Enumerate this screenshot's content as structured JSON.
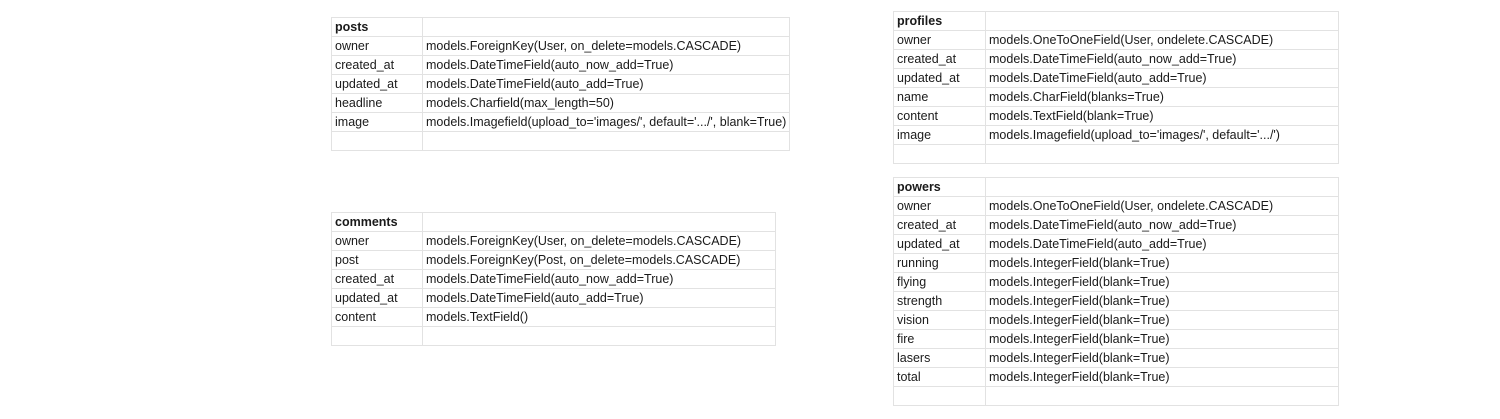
{
  "tables": {
    "posts": {
      "title": "posts",
      "rows": [
        {
          "field": "owner",
          "definition": "models.ForeignKey(User, on_delete=models.CASCADE)"
        },
        {
          "field": "created_at",
          "definition": "models.DateTimeField(auto_now_add=True)"
        },
        {
          "field": "updated_at",
          "definition": "models.DateTimeField(auto_add=True)"
        },
        {
          "field": "headline",
          "definition": "models.Charfield(max_length=50)"
        },
        {
          "field": "image",
          "definition": "models.Imagefield(upload_to='images/', default='.../', blank=True)"
        }
      ]
    },
    "comments": {
      "title": "comments",
      "rows": [
        {
          "field": "owner",
          "definition": "models.ForeignKey(User, on_delete=models.CASCADE)"
        },
        {
          "field": "post",
          "definition": "models.ForeignKey(Post, on_delete=models.CASCADE)"
        },
        {
          "field": "created_at",
          "definition": "models.DateTimeField(auto_now_add=True)"
        },
        {
          "field": "updated_at",
          "definition": "models.DateTimeField(auto_add=True)"
        },
        {
          "field": "content",
          "definition": "models.TextField()"
        }
      ]
    },
    "profiles": {
      "title": "profiles",
      "rows": [
        {
          "field": "owner",
          "definition": "models.OneToOneField(User, ondelete.CASCADE)"
        },
        {
          "field": "created_at",
          "definition": "models.DateTimeField(auto_now_add=True)"
        },
        {
          "field": "updated_at",
          "definition": "models.DateTimeField(auto_add=True)"
        },
        {
          "field": "name",
          "definition": "models.CharField(blanks=True)"
        },
        {
          "field": "content",
          "definition": "models.TextField(blank=True)"
        },
        {
          "field": "image",
          "definition": "models.Imagefield(upload_to='images/', default='.../')"
        }
      ]
    },
    "powers": {
      "title": "powers",
      "rows": [
        {
          "field": "owner",
          "definition": "models.OneToOneField(User, ondelete.CASCADE)"
        },
        {
          "field": "created_at",
          "definition": "models.DateTimeField(auto_now_add=True)"
        },
        {
          "field": "updated_at",
          "definition": "models.DateTimeField(auto_add=True)"
        },
        {
          "field": "running",
          "definition": "models.IntegerField(blank=True)"
        },
        {
          "field": "flying",
          "definition": "models.IntegerField(blank=True)"
        },
        {
          "field": "strength",
          "definition": "models.IntegerField(blank=True)"
        },
        {
          "field": "vision",
          "definition": "models.IntegerField(blank=True)"
        },
        {
          "field": "fire",
          "definition": "models.IntegerField(blank=True)"
        },
        {
          "field": "lasers",
          "definition": "models.IntegerField(blank=True)"
        },
        {
          "field": "total",
          "definition": "models.IntegerField(blank=True)"
        }
      ]
    }
  }
}
